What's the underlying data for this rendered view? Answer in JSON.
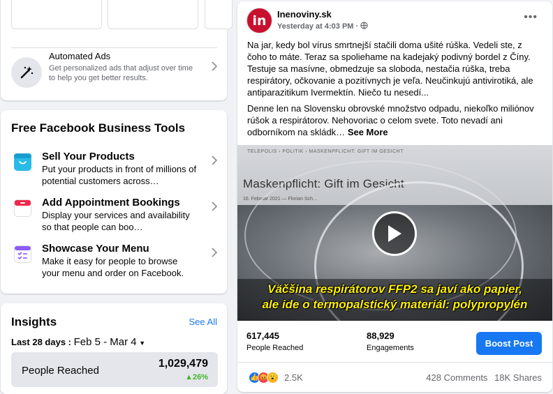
{
  "left": {
    "automated_ads": {
      "title": "Automated Ads",
      "description": "Get personalized ads that adjust over time to help you get better results."
    },
    "tools": {
      "title": "Free Facebook Business Tools",
      "items": [
        {
          "title": "Sell Your Products",
          "description": "Put your products in front of millions of potential customers across…",
          "color": "#2abbe8"
        },
        {
          "title": "Add Appointment Bookings",
          "description": "Display your services and availability so that people can boo…",
          "color": "#f02849"
        },
        {
          "title": "Showcase Your Menu",
          "description": "Make it easy for people to browse your menu and order on Facebook.",
          "color": "#8b5cf6"
        }
      ]
    },
    "insights": {
      "title": "Insights",
      "see_all": "See All",
      "range_label": "Last 28 days :",
      "range_value": "Feb 5 - Mar 4",
      "metric_label": "People Reached",
      "metric_value": "1,029,479",
      "metric_delta": "26%"
    }
  },
  "post": {
    "page_name": "Inenoviny.sk",
    "time": "Yesterday at 4:03 PM ·",
    "avatar_text": "in",
    "paragraph_1": "Na jar, kedy bol vírus smrtnejší stačili doma ušité rúška. Vedeli ste, z čoho to máte. Teraz sa spoliehame na kadejaký podivný bordel z Číny. Testuje sa masívne, obmedzuje sa sloboda, nestačia rúška, treba respirátory, očkovanie a pozitívnych je veľa. Neučinkujú antivirotiká, ale antiparazitikum Ivermektín. Niečo tu nesedí...",
    "paragraph_2": "Denne len na Slovensku obrovské množstvo odpadu, niekoľko miliónov rúšok a respirátorov. Nehovoriac o celom svete. Toto nevadí ani odborníkom na skládk…",
    "see_more": "See More",
    "video": {
      "crumb": "TELEPOLIS  ›  POLITIK  ›  MASKENPFLICHT: GIFT IM GESICHT",
      "headline": "Maskenpflicht: Gift im Gesicht",
      "byline": "16. Februar 2021  —  Florian Sch…",
      "caption_1": "Väčšina respirátorov FFP2 sa javí ako papier,",
      "caption_2": "ale ide o termopalstický materiál: polypropylén"
    },
    "stats": {
      "reached_value": "617,445",
      "reached_label": "People Reached",
      "engagements_value": "88,929",
      "engagements_label": "Engagements",
      "boost_label": "Boost Post"
    },
    "reactions": {
      "count": "2.5K",
      "comments": "428 Comments",
      "shares": "18K Shares"
    }
  }
}
